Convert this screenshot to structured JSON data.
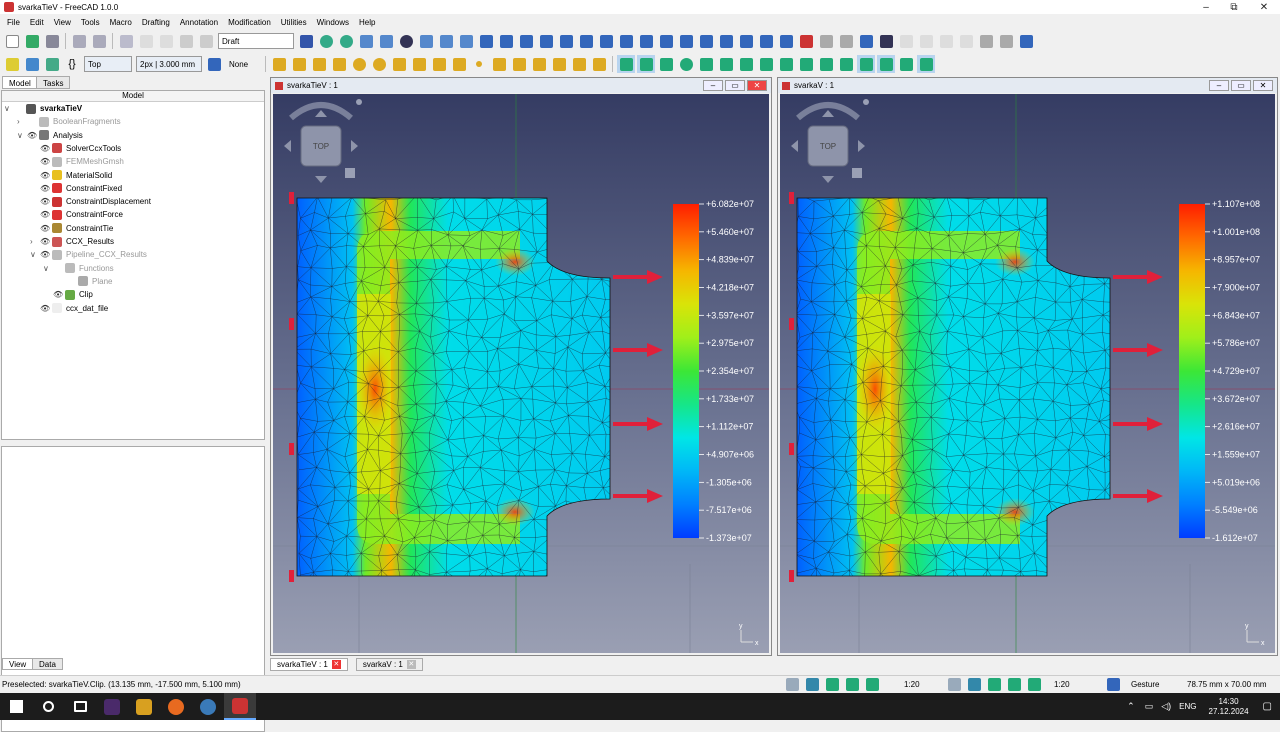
{
  "window": {
    "title": "svarkaTieV - FreeCAD 1.0.0",
    "controls": [
      "–",
      "⧉",
      "✕"
    ]
  },
  "menu": [
    "File",
    "Edit",
    "View",
    "Tools",
    "Macro",
    "Drafting",
    "Annotation",
    "Modification",
    "Utilities",
    "Windows",
    "Help"
  ],
  "toolbar": {
    "workbench": "Draft",
    "view_preset": "Top",
    "line_style": "2px | 3.000 mm",
    "snap_none": "None"
  },
  "panel": {
    "tabs": [
      "Model",
      "Tasks"
    ],
    "header": "Model",
    "bottom_tabs": [
      "View",
      "Data"
    ]
  },
  "tree": [
    {
      "label": "svarkaTieV",
      "level": 0,
      "bold": true,
      "expander": "∨",
      "eye": "",
      "icon": "#555",
      "dim": false
    },
    {
      "label": "BooleanFragments",
      "level": 1,
      "expander": "›",
      "eye": "",
      "icon": "#bbb",
      "dim": true
    },
    {
      "label": "Analysis",
      "level": 1,
      "expander": "∨",
      "eye": "👁",
      "icon": "#777",
      "dim": false
    },
    {
      "label": "SolverCcxTools",
      "level": 2,
      "expander": "",
      "eye": "👁",
      "icon": "#c44",
      "dim": false
    },
    {
      "label": "FEMMeshGmsh",
      "level": 2,
      "expander": "",
      "eye": "👁",
      "icon": "#bbb",
      "dim": true
    },
    {
      "label": "MaterialSolid",
      "level": 2,
      "expander": "",
      "eye": "👁",
      "icon": "#e8c020",
      "dim": false
    },
    {
      "label": "ConstraintFixed",
      "level": 2,
      "expander": "",
      "eye": "👁",
      "icon": "#d33",
      "dim": false
    },
    {
      "label": "ConstraintDisplacement",
      "level": 2,
      "expander": "",
      "eye": "👁",
      "icon": "#c33",
      "dim": false
    },
    {
      "label": "ConstraintForce",
      "level": 2,
      "expander": "",
      "eye": "👁",
      "icon": "#d33",
      "dim": false
    },
    {
      "label": "ConstraintTie",
      "level": 2,
      "expander": "",
      "eye": "👁",
      "icon": "#a83",
      "dim": false
    },
    {
      "label": "CCX_Results",
      "level": 2,
      "expander": "›",
      "eye": "👁",
      "icon": "#c55",
      "dim": false
    },
    {
      "label": "Pipeline_CCX_Results",
      "level": 2,
      "expander": "∨",
      "eye": "👁",
      "icon": "#bbb",
      "dim": true
    },
    {
      "label": "Functions",
      "level": 3,
      "expander": "∨",
      "eye": "",
      "icon": "#bbb",
      "dim": true
    },
    {
      "label": "Plane",
      "level": 4,
      "expander": "",
      "eye": "",
      "icon": "#aaa",
      "dim": true
    },
    {
      "label": "Clip",
      "level": 3,
      "expander": "",
      "eye": "👁",
      "icon": "#6a4",
      "dim": false
    },
    {
      "label": "ccx_dat_file",
      "level": 2,
      "expander": "",
      "eye": "👁",
      "icon": "#eee",
      "dim": false
    }
  ],
  "views": [
    {
      "title": "svarkaTieV : 1",
      "scale": [
        "+6.082e+07",
        "+5.460e+07",
        "+4.839e+07",
        "+4.218e+07",
        "+3.597e+07",
        "+2.975e+07",
        "+2.354e+07",
        "+1.733e+07",
        "+1.112e+07",
        "+4.907e+06",
        "-1.305e+06",
        "-7.517e+06",
        "-1.373e+07"
      ]
    },
    {
      "title": "svarkaV : 1",
      "scale": [
        "+1.107e+08",
        "+1.001e+08",
        "+8.957e+07",
        "+7.900e+07",
        "+6.843e+07",
        "+5.786e+07",
        "+4.729e+07",
        "+3.672e+07",
        "+2.616e+07",
        "+1.559e+07",
        "+5.019e+06",
        "-5.549e+06",
        "-1.612e+07"
      ]
    }
  ],
  "navcube_label": "TOP",
  "axis": {
    "x": "x",
    "y": "y"
  },
  "doc_tabs": [
    "svarkaTieV : 1",
    "svarkaV : 1"
  ],
  "status": {
    "preselected": "Preselected: svarkaTieV.Clip. (13.135 mm, -17.500 mm, 5.100 mm)",
    "scale1": "1:20",
    "scale2": "1:20",
    "nav_style": "Gesture",
    "dimensions": "78.75 mm x 70.00 mm"
  },
  "taskbar": {
    "lang": "ENG",
    "time": "14:30",
    "date": "27.12.2024"
  },
  "colors": {
    "accent": "#0078d7",
    "force_arrow": "#e0203a",
    "mesh_line": "#1a1a2a"
  }
}
